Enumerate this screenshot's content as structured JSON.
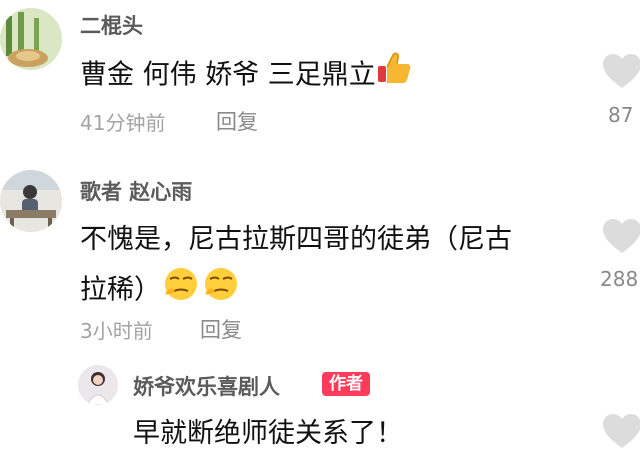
{
  "comments": [
    {
      "username": "二棍头",
      "text": "曹金 何伟 娇爷 三足鼎立",
      "time": "41分钟前",
      "reply": "回复",
      "likes": "87"
    },
    {
      "username": "歌者 赵心雨",
      "text_line1": "不愧是，尼古拉斯四哥的徒弟（尼古",
      "text_line2": "拉稀）",
      "time": "3小时前",
      "reply": "回复",
      "likes": "288"
    },
    {
      "username": "娇爷欢乐喜剧人",
      "badge": "作者",
      "text": "早就断绝师徒关系了！"
    }
  ],
  "icons": {
    "like": "heart-outline-icon",
    "thumbs_up": "thumbs-up-emoji",
    "smirk": "smirk-emoji"
  }
}
